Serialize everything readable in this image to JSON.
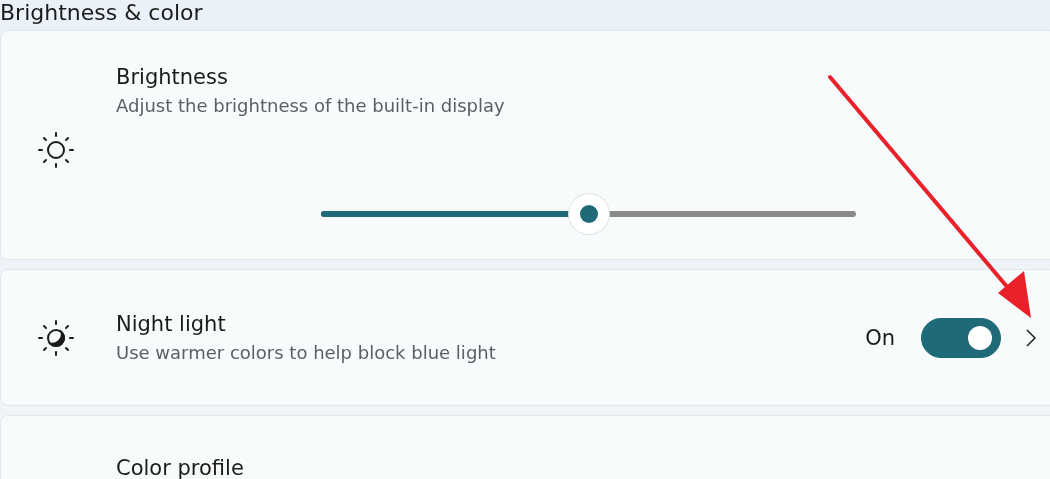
{
  "section_title": "Brightness & color",
  "brightness": {
    "title": "Brightness",
    "description": "Adjust the brightness of the built-in display",
    "level": 0.5
  },
  "night_light": {
    "title": "Night light",
    "description": "Use warmer colors to help block blue light",
    "state_label": "On",
    "on": true
  },
  "color_profile": {
    "title": "Color profile"
  }
}
